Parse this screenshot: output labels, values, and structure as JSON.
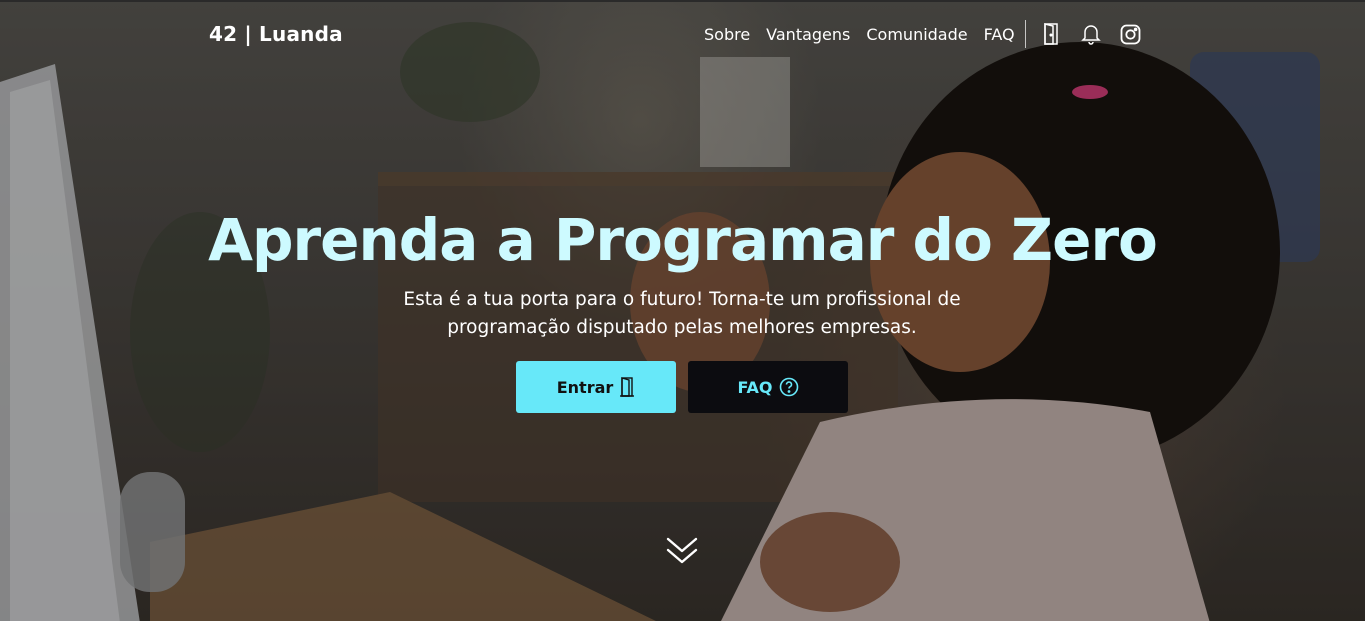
{
  "brand": "42 | Luanda",
  "nav": {
    "links": [
      "Sobre",
      "Vantagens",
      "Comunidade",
      "FAQ"
    ],
    "icons": [
      "door-icon",
      "bell-icon",
      "instagram-icon"
    ]
  },
  "hero": {
    "title": "Aprenda a Programar do Zero",
    "subtitle_line1": "Esta é a tua porta para o futuro! Torna-te um profissional de",
    "subtitle_line2": "programação disputado pelas melhores empresas.",
    "primary_button": "Entrar",
    "secondary_button": "FAQ",
    "scroll_icon": "double-chevron-down-icon"
  },
  "colors": {
    "accent": "#67e8f9",
    "title": "#cdfaff",
    "dark_button": "#0c0c10"
  }
}
